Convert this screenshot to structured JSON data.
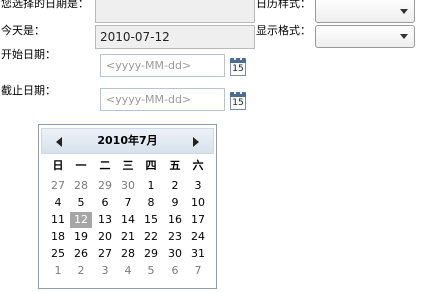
{
  "labels": {
    "selected_date": "您选择的日期是：",
    "today": "今天是：",
    "start_date": "开始日期：",
    "end_date": "截止日期：",
    "calendar_style": "日历样式：",
    "display_format": "显示格式："
  },
  "fields": {
    "selected_date_value": "",
    "today_value": "2010-07-12",
    "calendar_style_value": "",
    "display_format_value": "",
    "start_date_placeholder": "<yyyy-MM-dd>",
    "end_date_placeholder": "<yyyy-MM-dd>"
  },
  "calendar_button_text": "15",
  "calendar": {
    "title": "2010年7月",
    "weekdays": [
      "日",
      "一",
      "二",
      "三",
      "四",
      "五",
      "六"
    ],
    "selected_day": "12",
    "weeks": [
      [
        {
          "d": "27",
          "o": true
        },
        {
          "d": "28",
          "o": true
        },
        {
          "d": "29",
          "o": true
        },
        {
          "d": "30",
          "o": true
        },
        {
          "d": "1"
        },
        {
          "d": "2"
        },
        {
          "d": "3"
        }
      ],
      [
        {
          "d": "4"
        },
        {
          "d": "5"
        },
        {
          "d": "6"
        },
        {
          "d": "7"
        },
        {
          "d": "8"
        },
        {
          "d": "9"
        },
        {
          "d": "10"
        }
      ],
      [
        {
          "d": "11"
        },
        {
          "d": "12",
          "t": true
        },
        {
          "d": "13"
        },
        {
          "d": "14"
        },
        {
          "d": "15"
        },
        {
          "d": "16"
        },
        {
          "d": "17"
        }
      ],
      [
        {
          "d": "18"
        },
        {
          "d": "19"
        },
        {
          "d": "20"
        },
        {
          "d": "21"
        },
        {
          "d": "22"
        },
        {
          "d": "23"
        },
        {
          "d": "24"
        }
      ],
      [
        {
          "d": "25"
        },
        {
          "d": "26"
        },
        {
          "d": "27"
        },
        {
          "d": "28"
        },
        {
          "d": "29"
        },
        {
          "d": "30"
        },
        {
          "d": "31"
        }
      ],
      [
        {
          "d": "1",
          "o": true
        },
        {
          "d": "2",
          "o": true
        },
        {
          "d": "3",
          "o": true
        },
        {
          "d": "4",
          "o": true
        },
        {
          "d": "5",
          "o": true
        },
        {
          "d": "6",
          "o": true
        },
        {
          "d": "7",
          "o": true
        }
      ]
    ]
  }
}
